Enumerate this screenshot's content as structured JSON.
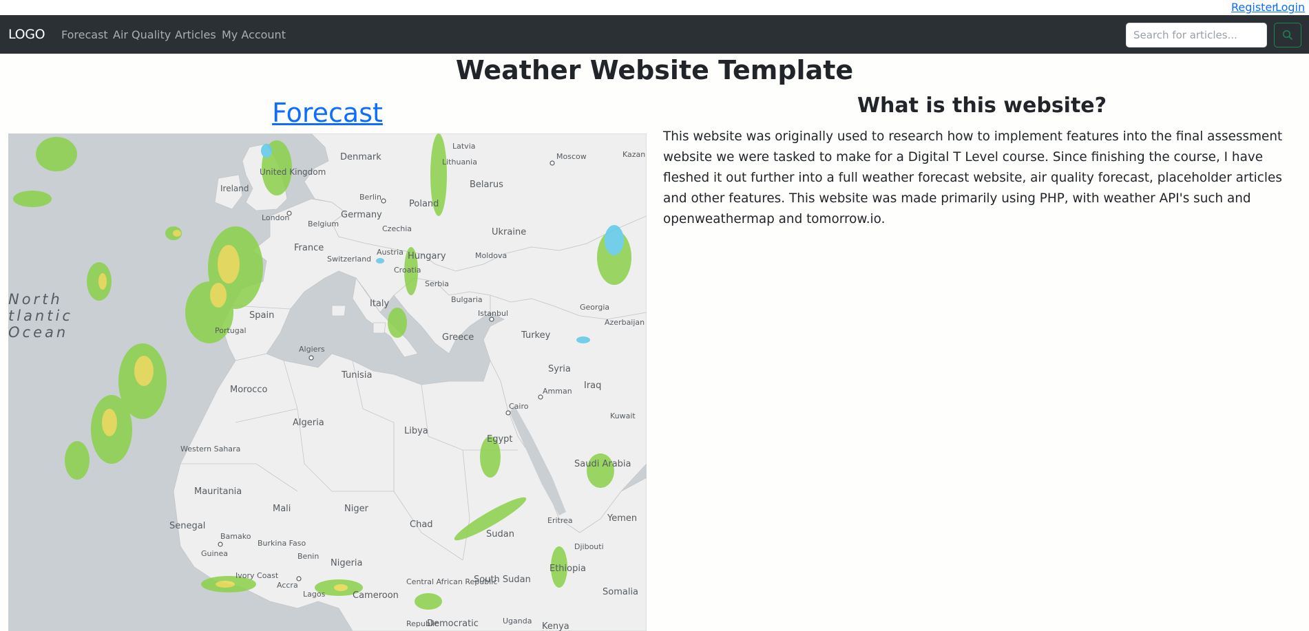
{
  "topbar": {
    "register": "Register",
    "login": "Login"
  },
  "nav": {
    "logo": "LOGO",
    "links": [
      "Forecast",
      "Air Quality",
      "Articles",
      "My Account"
    ],
    "search_placeholder": "Search for articles..."
  },
  "page_title": "Weather Website Template",
  "forecast": {
    "heading": "Forecast"
  },
  "about": {
    "heading": "What is this website?",
    "body": "This website was originally used to research how to implement features into the final assessment website we were tasked to make for a Digital T Level course. Since finishing the course, I have fleshed it out further into a full weather forecast website, air quality forecast, placeholder articles and other features. This website was made primarily using PHP, with weather API's such and openweathermap and tomorrow.io."
  },
  "map": {
    "ocean_label": [
      "North",
      "tlantic",
      "Ocean"
    ],
    "countries": [
      "Denmark",
      "Latvia",
      "Lithuania",
      "Belarus",
      "United Kingdom",
      "Ireland",
      "Berlin",
      "Poland",
      "Germany",
      "London",
      "Belgium",
      "Czechia",
      "Ukraine",
      "France",
      "Austria",
      "Hungary",
      "Moldova",
      "Switzerland",
      "Croatia",
      "Serbia",
      "Spain",
      "Italy",
      "Bulgaria",
      "Portugal",
      "Istanbul",
      "Georgia",
      "Azerbaijan",
      "Greece",
      "Turkey",
      "Algiers",
      "Tunisia",
      "Syria",
      "Morocco",
      "Iraq",
      "Amman",
      "Cairo",
      "Kuwait",
      "Algeria",
      "Libya",
      "Egypt",
      "Western Sahara",
      "Saudi Arabia",
      "Mauritania",
      "Mali",
      "Niger",
      "Chad",
      "Sudan",
      "Eritrea",
      "Yemen",
      "Senegal",
      "Bamako",
      "Burkina Faso",
      "Djibouti",
      "Guinea",
      "Benin",
      "Nigeria",
      "Ethiopia",
      "Ivory Coast",
      "Accra",
      "Lagos",
      "Cameroon",
      "Central African Republic",
      "South Sudan",
      "Somalia",
      "Moscow",
      "Kazan",
      "Republic",
      "Democratic",
      "Uganda",
      "Kenya"
    ]
  }
}
